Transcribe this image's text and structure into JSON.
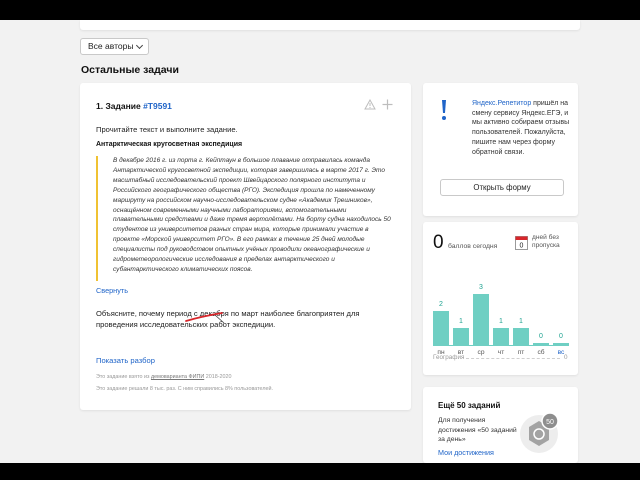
{
  "filter": {
    "label": "Все авторы"
  },
  "section_title": "Остальные задачи",
  "task": {
    "head_prefix": "1. Задание ",
    "number": "#T9591",
    "instruction": "Прочитайте текст и выполните задание.",
    "text_title": "Антарктическая кругосветная экспедиция",
    "quote": "В декабре 2016 г. из порта г. Кейптаун в большое плавание отправилась команда Антарктической кругосветной экспедиции, которая завершилась в марте 2017 г. Это масштабный исследовательский проект Швейцарского полярного института и Российского географического общества (РГО). Экспедиция прошла по намеченному маршруту на российском научно-исследовательском судне «Академик Трешников», оснащённом современными научными лабораториями, вспомогательными плавательными средствами и даже тремя вертолётами. На борту судна находилось 50 студентов из университетов разных стран мира, которые принимали участие в проекте «Морской университет РГО». В его рамках в течение 25 дней молодые специалисты под руководством опытных учёных проводили океанографические и гидрометеорологические исследования в пределах антарктического и субантарктического климатических поясов.",
    "collapse": "Свернуть",
    "question": "Объясните, почему период с декабря по март наиболее благоприятен для проведения исследовательских работ экспедиции.",
    "solution": "Показать разбор",
    "source_prefix": "Это задание взято из ",
    "source_link": "демоварианта ФИПИ",
    "source_suffix": " 2018-2020",
    "solved": "Это задание решали 8 тыс. раз. С ним справились 8% пользователей."
  },
  "feedback": {
    "brand": "Яндекс.Репетитор",
    "text": " пришёл на смену сервису Яндекс.ЕГЭ, и мы активно собираем отзывы пользователей. Пожалуйста, пишите нам через форму обратной связи.",
    "button": "Открыть форму"
  },
  "stats": {
    "score": "0",
    "score_label": "баллов сегодня",
    "calendar_day": "0",
    "missed_label": "дней без пропуска",
    "geo_label": "География",
    "geo_value": "0"
  },
  "chart_data": {
    "type": "bar",
    "categories": [
      "пн",
      "вт",
      "ср",
      "чт",
      "пт",
      "сб",
      "вс"
    ],
    "values": [
      2,
      1,
      3,
      1,
      1,
      0,
      0
    ],
    "ylim": [
      0,
      3
    ],
    "highlight_category": "вс",
    "bar_color": "#6fcfc3",
    "label_color": "#1fa391"
  },
  "achievements": {
    "title": "Ещё 50 заданий",
    "text": "Для получения достижения «50 заданий за день»",
    "link": "Мои достижения",
    "badge": "50"
  },
  "colors": {
    "link": "#1f64c8",
    "accent_border": "#f0c232",
    "annotation": "#d8262b"
  }
}
